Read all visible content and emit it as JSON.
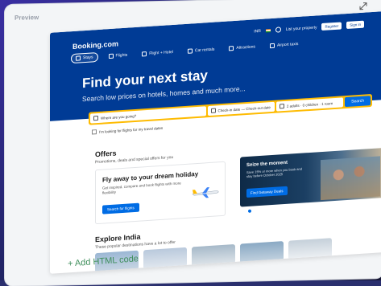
{
  "preview": {
    "label": "Preview",
    "add_html_label": "+ Add HTML code"
  },
  "site": {
    "logo": "Booking.com",
    "currency": "INR",
    "list_property": "List your property",
    "register": "Register",
    "sign_in": "Sign in",
    "nav_tabs": [
      {
        "label": "Stays",
        "icon": "bed-icon",
        "active": true
      },
      {
        "label": "Flights",
        "icon": "plane-icon",
        "active": false
      },
      {
        "label": "Flight + Hotel",
        "icon": "plane-hotel-icon",
        "active": false
      },
      {
        "label": "Car rentals",
        "icon": "car-icon",
        "active": false
      },
      {
        "label": "Attractions",
        "icon": "attractions-icon",
        "active": false
      },
      {
        "label": "Airport taxis",
        "icon": "taxi-icon",
        "active": false
      }
    ],
    "hero_title": "Find your next stay",
    "hero_subtitle": "Search low prices on hotels, homes and much more...",
    "search": {
      "destination_placeholder": "Where are you going?",
      "dates": "Check-in date — Check-out date",
      "guests": "2 adults · 0 children · 1 room",
      "button": "Search"
    },
    "flights_checkbox": "I'm looking for flights for my travel dates",
    "offers": {
      "title": "Offers",
      "subtitle": "Promotions, deals and special offers for you",
      "card1": {
        "title": "Fly away to your dream holiday",
        "desc": "Get inspired, compare and book flights with more flexibility",
        "button": "Search for flights"
      },
      "card2": {
        "title": "Seize the moment",
        "desc": "Save 15% or more when you book and stay before October 2025",
        "button": "Find Getaway Deals"
      }
    },
    "explore": {
      "title": "Explore India",
      "subtitle": "These popular destinations have a lot to offer"
    },
    "colors": {
      "brand_blue": "#003b95",
      "search_yellow": "#febb02",
      "button_blue": "#006ce4",
      "add_html_green": "#3f8f5c"
    }
  }
}
